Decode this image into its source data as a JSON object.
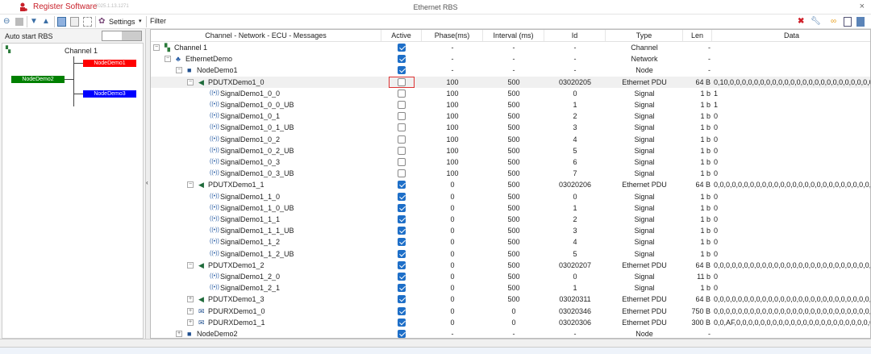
{
  "app": {
    "name": "Register Software",
    "version": "2025.1.13.1271",
    "window_title": "Ethernet RBS",
    "close": "×"
  },
  "colors": {
    "accent": "#1e6fc8",
    "brand": "#c8202a",
    "node1": "#ff0000",
    "node2": "#008000",
    "node3": "#0000ff"
  },
  "toolbar": {
    "settings_label": "Settings",
    "filter_label": "Filter"
  },
  "left": {
    "auto_start_label": "Auto start RBS",
    "auto_start_on": false,
    "channel": "Channel 1",
    "nodes": [
      "NodeDemo1",
      "NodeDemo2",
      "NodeDemo3"
    ]
  },
  "columns": [
    "Channel - Network - ECU - Messages",
    "Active",
    "Phase(ms)",
    "Interval (ms)",
    "Id",
    "Type",
    "Len",
    "Data"
  ],
  "rows": [
    {
      "name": "Channel 1",
      "level": 0,
      "icon": "channel-icon",
      "exp": "-",
      "active": true,
      "phase": "-",
      "interval": "-",
      "id": "-",
      "type": "Channel",
      "len": "-",
      "data": ""
    },
    {
      "name": "EthernetDemo",
      "level": 1,
      "icon": "network-icon",
      "exp": "-",
      "active": true,
      "phase": "-",
      "interval": "-",
      "id": "-",
      "type": "Network",
      "len": "-",
      "data": ""
    },
    {
      "name": "NodeDemo1",
      "level": 2,
      "icon": "node-icon",
      "exp": "-",
      "active": true,
      "phase": "-",
      "interval": "-",
      "id": "-",
      "type": "Node",
      "len": "-",
      "data": ""
    },
    {
      "name": "PDUTXDemo1_0",
      "level": 3,
      "icon": "tx-pdu-icon",
      "exp": "-",
      "active": false,
      "selected": true,
      "phase": "100",
      "interval": "500",
      "id": "03020205",
      "type": "Ethernet PDU",
      "len": "64 B",
      "data": "0,10,0,0,0,0,0,0,0,0,0,0,0,0,0,0,0,0,0,0,0,0,0,0,0,0,0,0,0,0,0,0,0,0,0,0"
    },
    {
      "name": "SignalDemo1_0_0",
      "level": 4,
      "icon": "signal-icon",
      "active": false,
      "phase": "100",
      "interval": "500",
      "id": "0",
      "type": "Signal",
      "len": "1 b",
      "data": "1"
    },
    {
      "name": "SignalDemo1_0_0_UB",
      "level": 4,
      "icon": "signal-icon",
      "active": false,
      "phase": "100",
      "interval": "500",
      "id": "1",
      "type": "Signal",
      "len": "1 b",
      "data": "1"
    },
    {
      "name": "SignalDemo1_0_1",
      "level": 4,
      "icon": "signal-icon",
      "active": false,
      "phase": "100",
      "interval": "500",
      "id": "2",
      "type": "Signal",
      "len": "1 b",
      "data": "0"
    },
    {
      "name": "SignalDemo1_0_1_UB",
      "level": 4,
      "icon": "signal-icon",
      "active": false,
      "phase": "100",
      "interval": "500",
      "id": "3",
      "type": "Signal",
      "len": "1 b",
      "data": "0"
    },
    {
      "name": "SignalDemo1_0_2",
      "level": 4,
      "icon": "signal-icon",
      "active": false,
      "phase": "100",
      "interval": "500",
      "id": "4",
      "type": "Signal",
      "len": "1 b",
      "data": "0"
    },
    {
      "name": "SignalDemo1_0_2_UB",
      "level": 4,
      "icon": "signal-icon",
      "active": false,
      "phase": "100",
      "interval": "500",
      "id": "5",
      "type": "Signal",
      "len": "1 b",
      "data": "0"
    },
    {
      "name": "SignalDemo1_0_3",
      "level": 4,
      "icon": "signal-icon",
      "active": false,
      "phase": "100",
      "interval": "500",
      "id": "6",
      "type": "Signal",
      "len": "1 b",
      "data": "0"
    },
    {
      "name": "SignalDemo1_0_3_UB",
      "level": 4,
      "icon": "signal-icon",
      "active": false,
      "phase": "100",
      "interval": "500",
      "id": "7",
      "type": "Signal",
      "len": "1 b",
      "data": "0"
    },
    {
      "name": "PDUTXDemo1_1",
      "level": 3,
      "icon": "tx-pdu-icon",
      "exp": "-",
      "active": true,
      "phase": "0",
      "interval": "500",
      "id": "03020206",
      "type": "Ethernet PDU",
      "len": "64 B",
      "data": "0,0,0,0,0,0,0,0,0,0,0,0,0,0,0,0,0,0,0,0,0,0,0,0,0,0,0,0,0,0,0,0,0,0,0,0,0"
    },
    {
      "name": "SignalDemo1_1_0",
      "level": 4,
      "icon": "signal-icon",
      "active": true,
      "phase": "0",
      "interval": "500",
      "id": "0",
      "type": "Signal",
      "len": "1 b",
      "data": "0"
    },
    {
      "name": "SignalDemo1_1_0_UB",
      "level": 4,
      "icon": "signal-icon",
      "active": true,
      "phase": "0",
      "interval": "500",
      "id": "1",
      "type": "Signal",
      "len": "1 b",
      "data": "0"
    },
    {
      "name": "SignalDemo1_1_1",
      "level": 4,
      "icon": "signal-icon",
      "active": true,
      "phase": "0",
      "interval": "500",
      "id": "2",
      "type": "Signal",
      "len": "1 b",
      "data": "0"
    },
    {
      "name": "SignalDemo1_1_1_UB",
      "level": 4,
      "icon": "signal-icon",
      "active": true,
      "phase": "0",
      "interval": "500",
      "id": "3",
      "type": "Signal",
      "len": "1 b",
      "data": "0"
    },
    {
      "name": "SignalDemo1_1_2",
      "level": 4,
      "icon": "signal-icon",
      "active": true,
      "phase": "0",
      "interval": "500",
      "id": "4",
      "type": "Signal",
      "len": "1 b",
      "data": "0"
    },
    {
      "name": "SignalDemo1_1_2_UB",
      "level": 4,
      "icon": "signal-icon",
      "active": true,
      "phase": "0",
      "interval": "500",
      "id": "5",
      "type": "Signal",
      "len": "1 b",
      "data": "0"
    },
    {
      "name": "PDUTXDemo1_2",
      "level": 3,
      "icon": "tx-pdu-icon",
      "exp": "-",
      "active": true,
      "phase": "0",
      "interval": "500",
      "id": "03020207",
      "type": "Ethernet PDU",
      "len": "64 B",
      "data": "0,0,0,0,0,0,0,0,0,0,0,0,0,0,0,0,0,0,0,0,0,0,0,0,0,0,0,0,0,0,0,0,0,0,0,0,0"
    },
    {
      "name": "SignalDemo1_2_0",
      "level": 4,
      "icon": "signal-icon",
      "active": true,
      "phase": "0",
      "interval": "500",
      "id": "0",
      "type": "Signal",
      "len": "11 b",
      "data": "0"
    },
    {
      "name": "SignalDemo1_2_1",
      "level": 4,
      "icon": "signal-icon",
      "active": true,
      "phase": "0",
      "interval": "500",
      "id": "1",
      "type": "Signal",
      "len": "1 b",
      "data": "0"
    },
    {
      "name": "PDUTXDemo1_3",
      "level": 3,
      "icon": "tx-pdu-icon",
      "exp": "+",
      "active": true,
      "phase": "0",
      "interval": "500",
      "id": "03020311",
      "type": "Ethernet PDU",
      "len": "64 B",
      "data": "0,0,0,0,0,0,0,0,0,0,0,0,0,0,0,0,0,0,0,0,0,0,0,0,0,0,0,0,0,0,0,0,0,0,0,0,0"
    },
    {
      "name": "PDURXDemo1_0",
      "level": 3,
      "icon": "rx-pdu-icon",
      "exp": "+",
      "active": true,
      "phase": "0",
      "interval": "0",
      "id": "03020346",
      "type": "Ethernet PDU",
      "len": "750 B",
      "data": "0,0,0,0,0,0,0,0,0,0,0,0,0,0,0,0,0,0,0,0,0,0,0,0,0,0,0,0,0,0,0,0,0,0,0,0,0"
    },
    {
      "name": "PDURXDemo1_1",
      "level": 3,
      "icon": "rx-pdu-icon",
      "exp": "+",
      "active": true,
      "phase": "0",
      "interval": "0",
      "id": "03020306",
      "type": "Ethernet PDU",
      "len": "300 B",
      "data": "0,0,AF,0,0,0,0,0,0,0,0,0,0,0,0,0,0,0,0,0,0,0,0,0,0,0,0,0,0,0,0,0,0,0,0"
    },
    {
      "name": "NodeDemo2",
      "level": 2,
      "icon": "node-icon",
      "exp": "+",
      "active": true,
      "phase": "-",
      "interval": "-",
      "id": "-",
      "type": "Node",
      "len": "-",
      "data": ""
    }
  ]
}
